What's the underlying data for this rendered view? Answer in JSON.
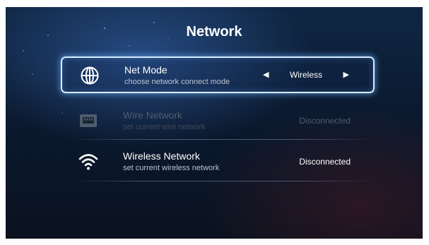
{
  "title": "Network",
  "net_mode": {
    "label": "Net Mode",
    "sub": "choose network connect mode",
    "value": "Wireless",
    "icon": "globe-icon"
  },
  "wire_network": {
    "label": "Wire Network",
    "sub": "set current wire network",
    "status": "Disconnected",
    "icon": "ethernet-port-icon"
  },
  "wireless_network": {
    "label": "Wireless Network",
    "sub": "set current wireless network",
    "status": "Disconnected",
    "icon": "wifi-icon"
  },
  "colors": {
    "accent": "#d6ecff",
    "background": "#0b1a30"
  }
}
